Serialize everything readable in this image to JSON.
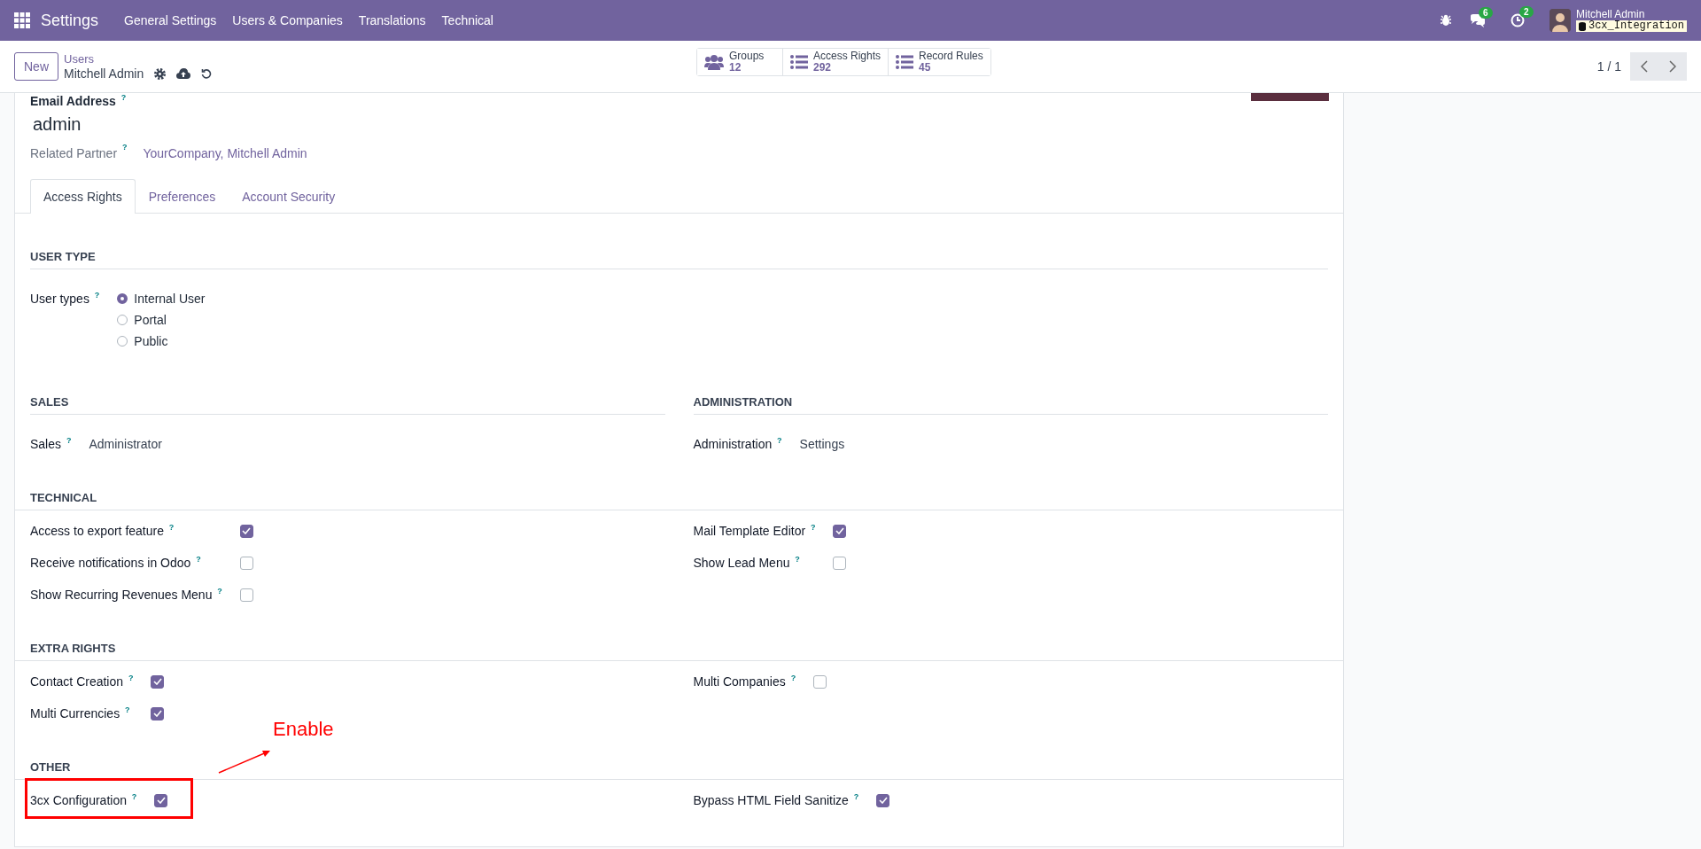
{
  "navbar": {
    "app": "Settings",
    "menu": [
      "General Settings",
      "Users & Companies",
      "Translations",
      "Technical"
    ],
    "messages_count": "6",
    "activities_count": "2",
    "user": "Mitchell Admin",
    "database": "3cx_Integration"
  },
  "control_panel": {
    "new_button": "New",
    "breadcrumb": "Users",
    "record": "Mitchell Admin",
    "smart_buttons": [
      {
        "label": "Groups",
        "value": "12",
        "kind": "users"
      },
      {
        "label": "Access Rights",
        "value": "292",
        "kind": "list"
      },
      {
        "label": "Record Rules",
        "value": "45",
        "kind": "list"
      }
    ],
    "pager": "1 / 1"
  },
  "form": {
    "email_label": "Email Address $^{?}$",
    "email": "admin",
    "partner_label": "Related Partner $^{?}$",
    "partner": "YourCompany, Mitchell Admin",
    "tabs": [
      {
        "label": "Access Rights",
        "selected": true
      },
      {
        "label": "Preferences",
        "selected": false
      },
      {
        "label": "Account Security",
        "selected": false
      }
    ],
    "groups": [
      {
        "columns": [
          {
            "title": "USER TYPE",
            "fields": [
              {
                "label": "User types $^{?}$",
                "kind": "radio",
                "options": [
                  {
                    "label": "Internal User",
                    "selected": true
                  },
                  {
                    "label": "Portal",
                    "selected": false
                  },
                  {
                    "label": "Public",
                    "selected": false
                  }
                ]
              }
            ]
          }
        ]
      },
      {
        "columns": [
          {
            "title": "SALES",
            "fields": [
              {
                "label": "Sales $^{?}$",
                "kind": "value",
                "value": "Administrator"
              }
            ]
          },
          {
            "title": "ADMINISTRATION",
            "fields": [
              {
                "label": "Administration $^{?}$",
                "kind": "value",
                "value": "Settings"
              }
            ]
          }
        ]
      },
      {
        "columns": [
          {
            "title": "TECHNICAL",
            "fields": [
              {
                "label": "Access to export feature $^{?}$",
                "kind": "checkbox",
                "checked": true
              },
              {
                "label": "Receive notifications in Odoo $^{?}$",
                "kind": "checkbox",
                "checked": false
              },
              {
                "label": "Show Recurring Revenues Menu $^{?}$",
                "kind": "checkbox",
                "checked": false
              }
            ]
          },
          {
            "fields": [
              {
                "label": "Mail Template Editor $^{?}$",
                "kind": "checkbox",
                "checked": true
              },
              {
                "label": "Show Lead Menu $^{?}$",
                "kind": "checkbox",
                "checked": false
              }
            ]
          }
        ]
      },
      {
        "columns": [
          {
            "title": "EXTRA RIGHTS",
            "fields": [
              {
                "label": "Contact Creation $^{?}$",
                "kind": "checkbox",
                "checked": true
              },
              {
                "label": "Multi Currencies $^{?}$",
                "kind": "checkbox",
                "checked": true
              }
            ]
          },
          {
            "fields": [
              {
                "label": "Multi Companies $^{?}$",
                "kind": "checkbox",
                "checked": false
              }
            ]
          }
        ]
      },
      {
        "columns": [
          {
            "title": "OTHER",
            "fields": [
              {
                "label": "3cx Configuration $^{?}$",
                "kind": "checkbox",
                "checked": true,
                "annotation": "Enable"
              }
            ]
          },
          {
            "fields": [
              {
                "label": "Bypass HTML Field Sanitize $^{?}$",
                "kind": "checkbox",
                "checked": true
              }
            ]
          }
        ]
      }
    ]
  }
}
